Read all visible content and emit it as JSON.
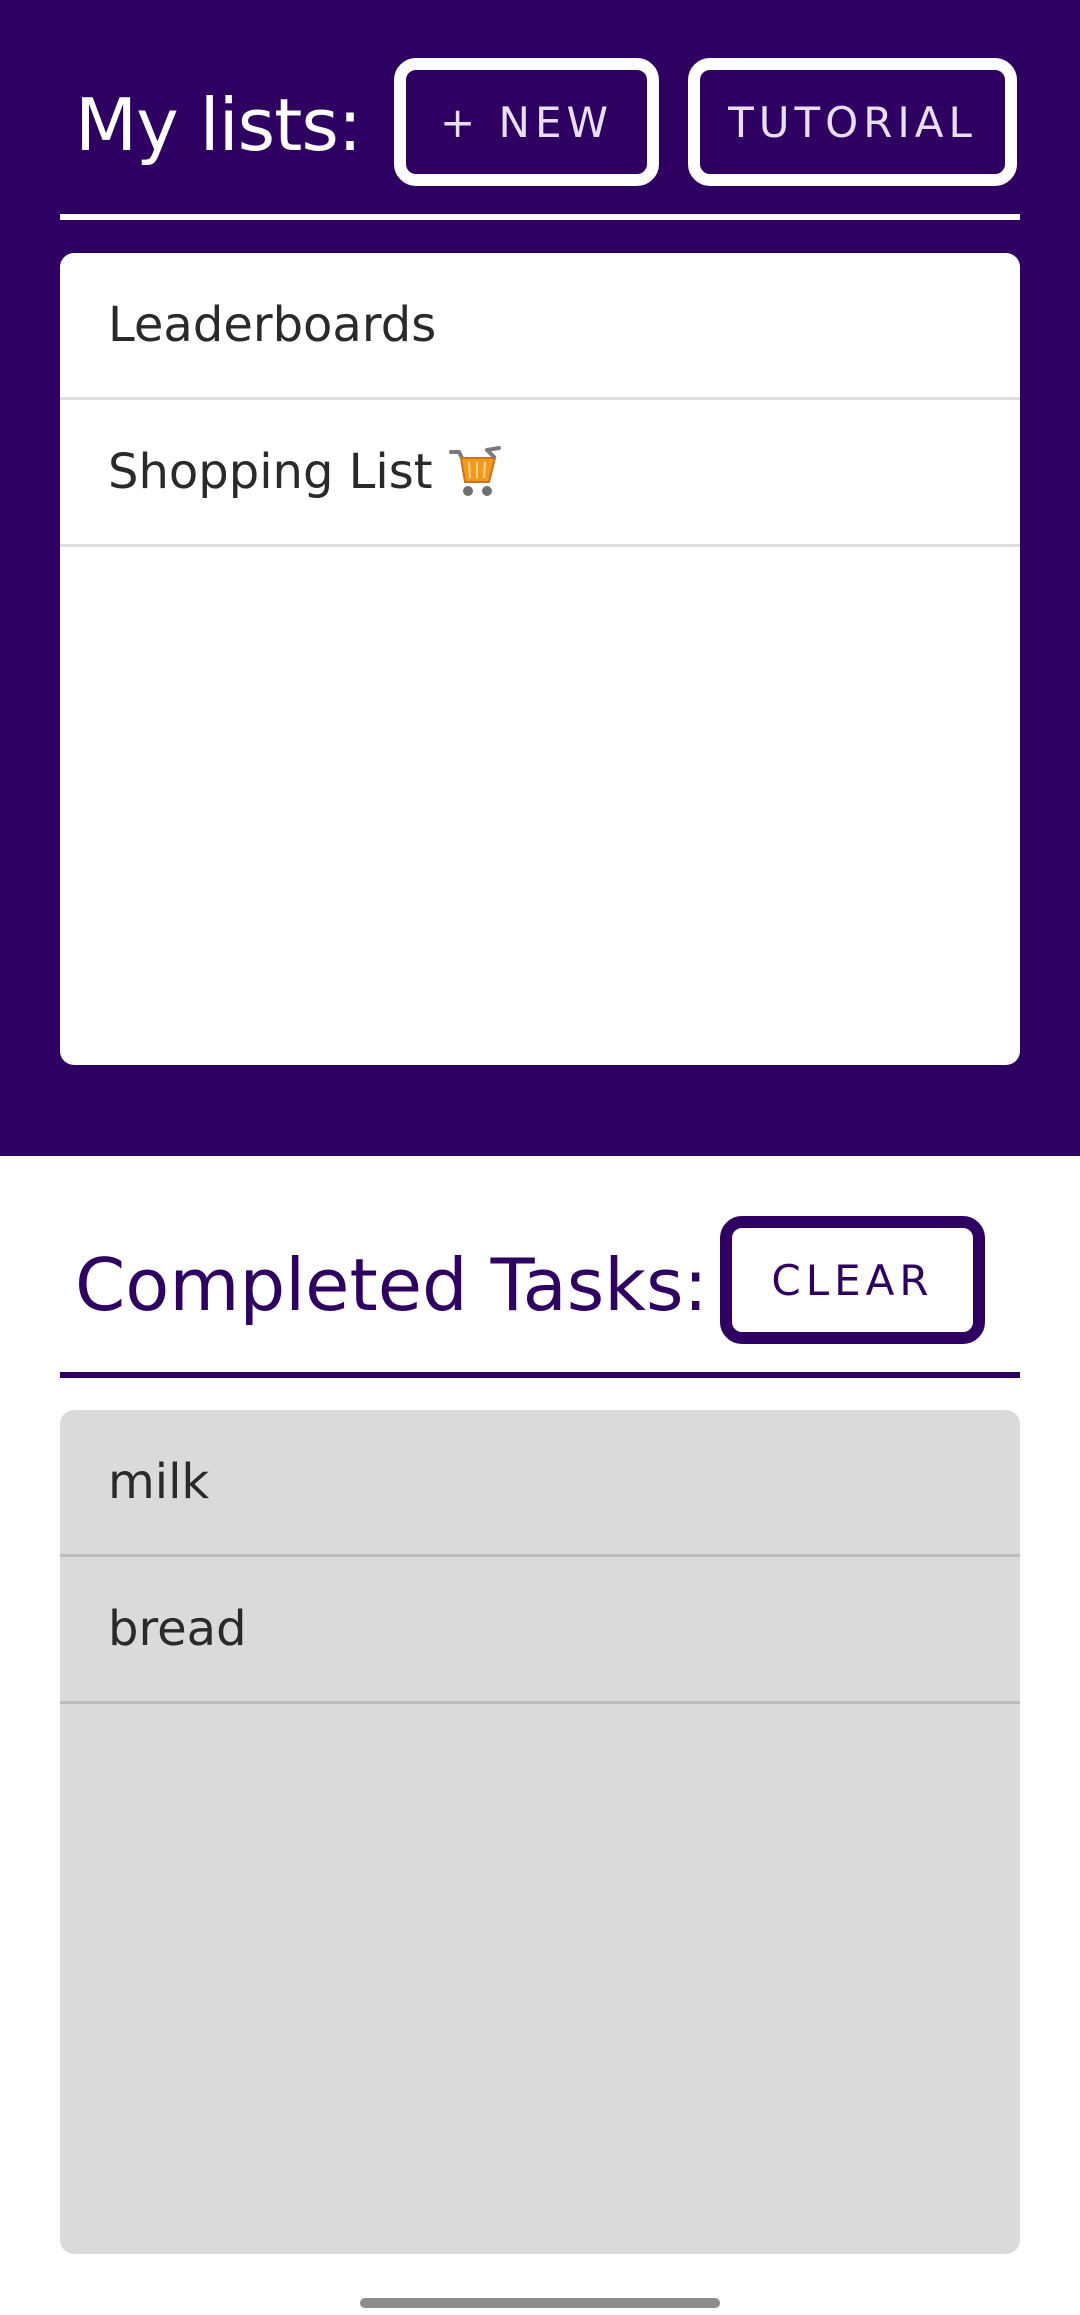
{
  "header": {
    "title": "My lists:",
    "new_button_label": "+ NEW",
    "tutorial_button_label": "TUTORIAL"
  },
  "lists": [
    {
      "label": "Leaderboards"
    },
    {
      "label": "Shopping List",
      "icon": "shopping-cart-icon"
    }
  ],
  "completed": {
    "title": "Completed Tasks:",
    "clear_button_label": "CLEAR",
    "items": [
      {
        "label": "milk"
      },
      {
        "label": "bread"
      }
    ]
  },
  "colors": {
    "accent": "#2e0062",
    "completed_panel": "#dadada"
  }
}
